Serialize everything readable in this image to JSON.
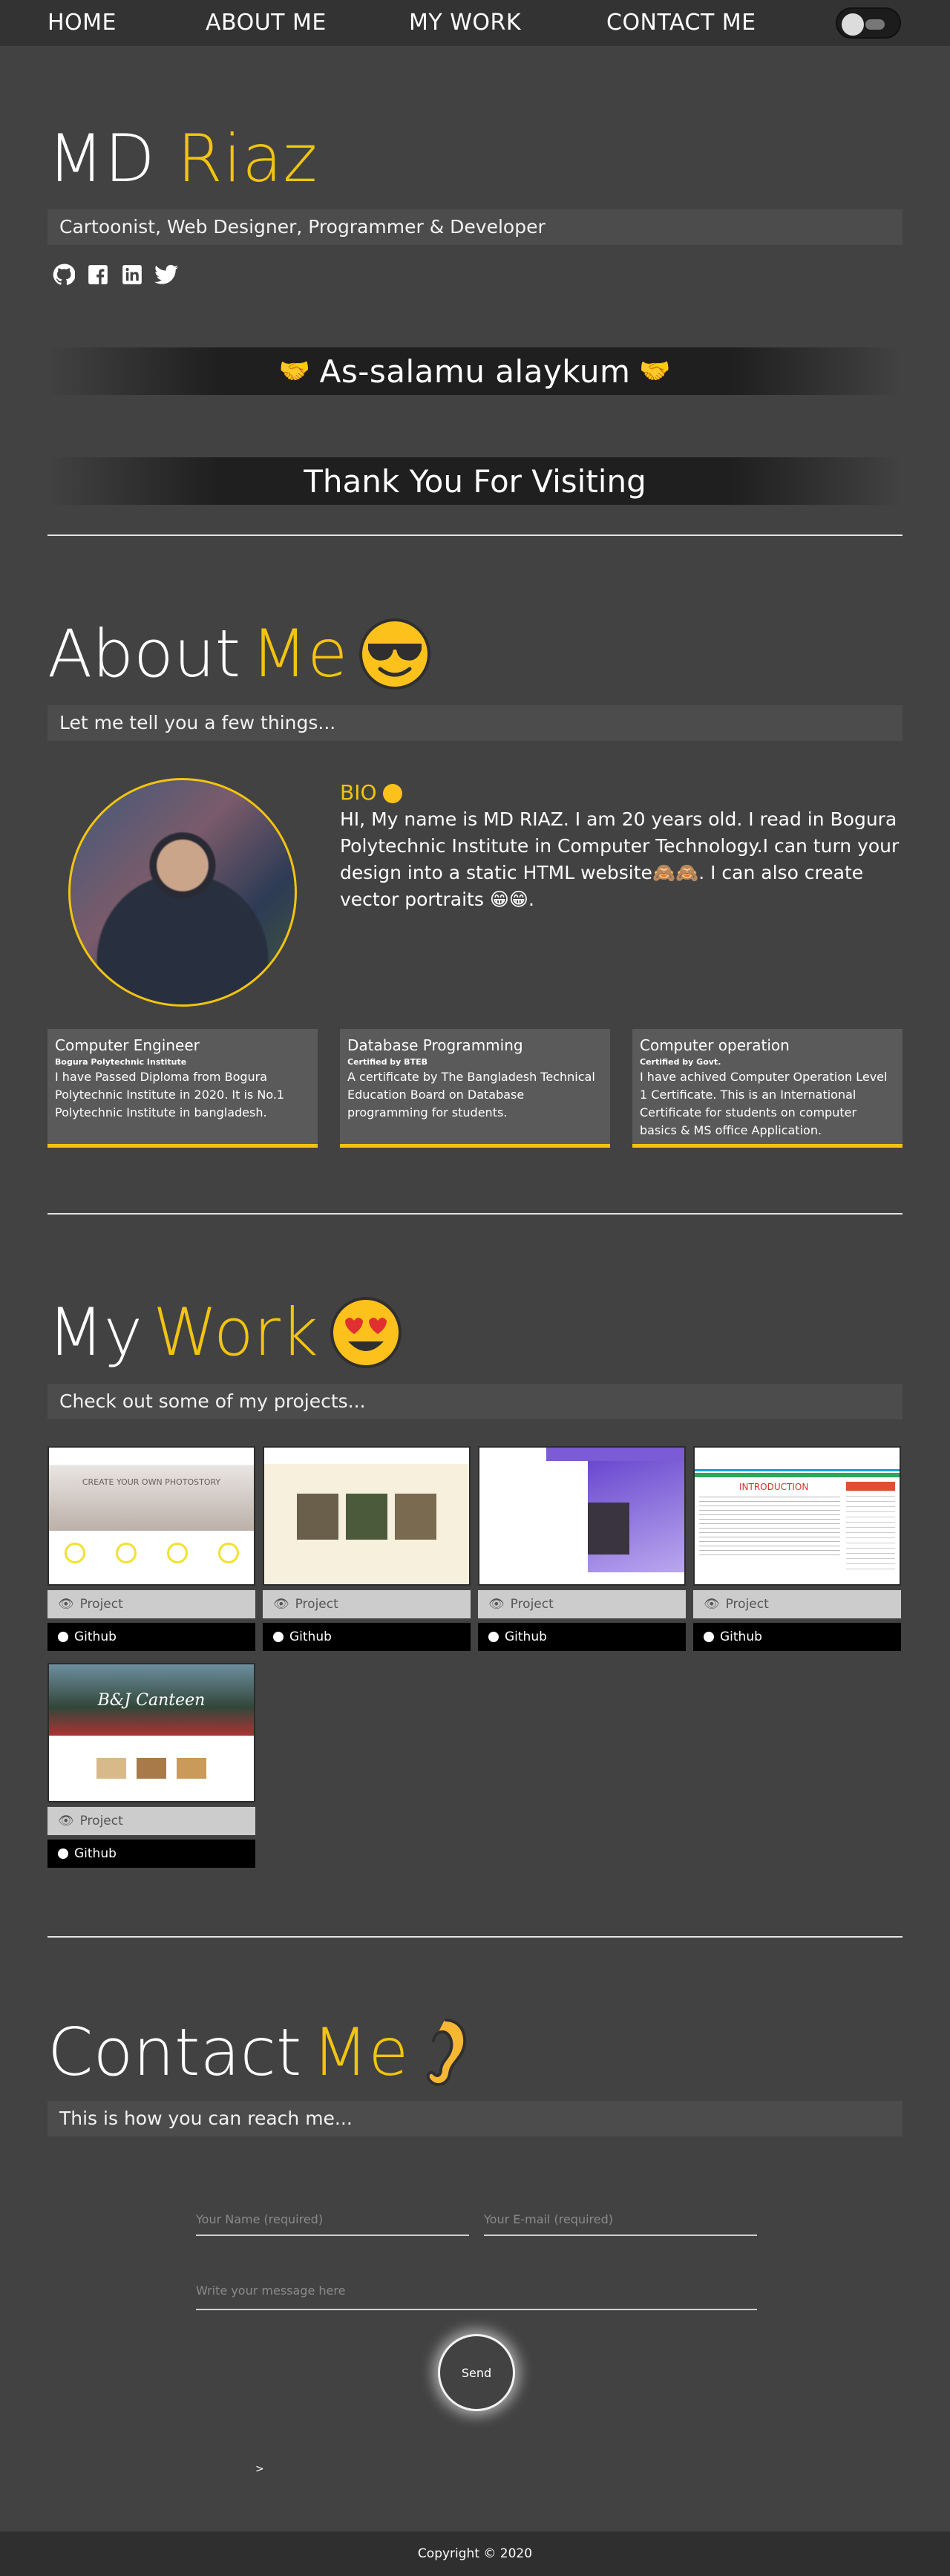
{
  "nav": {
    "home": "HOME",
    "about": "ABOUT ME",
    "work": "MY WORK",
    "contact": "CONTACT ME"
  },
  "hero": {
    "first": "MD",
    "last": "Riaz",
    "tagline": "Cartoonist, Web Designer, Programmer & Developer",
    "socials": [
      "github-icon",
      "facebook-icon",
      "linkedin-icon",
      "twitter-icon"
    ],
    "greeting": "As-salamu alaykum",
    "thanks": "Thank You For Visiting"
  },
  "about": {
    "title_a": "About",
    "title_b": "Me",
    "sub": "Let me tell you a few things...",
    "bio_heading": "BIO",
    "bio_text": "HI, My name is MD RIAZ. I am 20 years old. I read in Bogura Polytechnic Institute in Computer Technology.I can turn your design into a static HTML website",
    "bio_text2": ". I can also create vector portraits",
    "cards": [
      {
        "title": "Computer Engineer",
        "sub": "Bogura Polytechnic Institute",
        "body": "I have Passed Diploma from Bogura Polytechnic Institute in 2020. It is No.1 Polytechnic Institute in bangladesh."
      },
      {
        "title": "Database Programming",
        "sub": "Certified by BTEB",
        "body": "A certificate by The Bangladesh Technical Education Board on Database programming for students."
      },
      {
        "title": "Computer operation",
        "sub": "Certified by Govt.",
        "body": "I have achived Computer Operation Level 1 Certificate. This is an International Certificate for students on computer basics & MS office Application."
      }
    ]
  },
  "work": {
    "title_a": "My",
    "title_b": "Work",
    "sub": "Check out some of my projects...",
    "project_label": "Project",
    "github_label": "Github",
    "thumb_texts": [
      "CREATE YOUR OWN PHOTOSTORY",
      "",
      "",
      "INTRODUCTION",
      "B&J Canteen"
    ]
  },
  "contact": {
    "title_a": "Contact",
    "title_b": "Me",
    "sub": "This is how you can reach me...",
    "name_ph": "Your Name (required)",
    "email_ph": "Your E-mail (required)",
    "msg_ph": "Write your message here",
    "send": "Send",
    "mark": ">"
  },
  "footer": {
    "copyright": "Copyright © 2020"
  },
  "colors": {
    "accent": "#f2c40f",
    "background": "#424242",
    "nav": "#333333"
  }
}
